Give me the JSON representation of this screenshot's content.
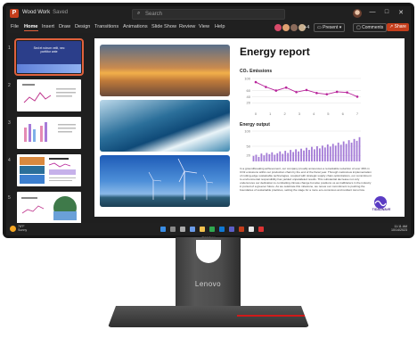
{
  "titlebar": {
    "app_icon": "powerpoint-icon",
    "doc_name": "Wood Work",
    "save_state": "Saved",
    "search_placeholder": "Search",
    "window_controls": [
      "—",
      "□",
      "✕"
    ]
  },
  "ribbon": {
    "tabs": [
      "File",
      "Home",
      "Insert",
      "Draw",
      "Design",
      "Transitions",
      "Animations",
      "Slide Show",
      "Review",
      "View",
      "Help"
    ],
    "active_tab": "Home",
    "collaborators_extra": "+4",
    "present_label": "Present",
    "comments_label": "Comments",
    "share_label": "Share"
  },
  "thumbnails": {
    "numbers": [
      "1",
      "2",
      "3",
      "4",
      "5"
    ],
    "slide1_text": "Sed et rutrum velit, nec porttitor ante"
  },
  "slide": {
    "title": "Energy report",
    "emissions_label": "CO₂ Emissions",
    "output_label": "Energy output",
    "paragraph": "In a groundbreaking achievement, our company proudly announces a remarkable reduction of over 30% in CO2 emissions within our production chain by the end of the fiscal year. Through meticulous implementation of cutting-edge sustainable technologies, coupled with strategic supply chain optimizations, our commitment to environmental responsibility has yielded unparalleled results. This substantial decrease not only underscores our dedication to combatting climate change but also positions us as trailblazers in the industry in pursuit of a greener future. As we celebrate this milestone, we renew our commitment to pushing the boundaries of sustainable practices, setting the stage for a more eco-conscious and resilient tomorrow.",
    "logo_text": "TIDALWAVE"
  },
  "taskbar": {
    "weather_temp": "78°F",
    "weather_desc": "Sunny",
    "time": "11:11 AM",
    "date": "10/14/2023"
  },
  "monitor": {
    "brand": "Lenovo",
    "hinge_label": "ThinkVision"
  },
  "colors": {
    "accent": "#c43e1c",
    "chart_line": "#b8239a",
    "chart_bar": "#a37ad6"
  },
  "chart_data": [
    {
      "type": "line",
      "title": "CO₂ Emissions",
      "x": [
        0,
        1,
        2,
        3,
        4,
        5,
        6,
        7
      ],
      "y": [
        88,
        72,
        60,
        70,
        55,
        62,
        52,
        48,
        56,
        54,
        40
      ],
      "ylim": [
        0,
        100
      ],
      "ytick_labels": [
        "100",
        "60",
        "40",
        "20"
      ],
      "xtick_labels": [
        "0",
        "1",
        "2",
        "3",
        "4",
        "5",
        "6",
        "7"
      ],
      "grid": true
    },
    {
      "type": "bar",
      "title": "Energy output",
      "values": [
        18,
        22,
        15,
        26,
        20,
        28,
        24,
        30,
        22,
        27,
        33,
        25,
        35,
        28,
        38,
        31,
        40,
        33,
        42,
        36,
        45,
        38,
        48,
        40,
        50,
        43,
        52,
        46,
        56,
        49,
        58,
        52,
        62,
        55,
        66,
        58,
        70,
        62,
        74,
        68,
        80
      ],
      "ylim": [
        0,
        100
      ],
      "ytick_labels": [
        "100",
        "50",
        "20"
      ],
      "grid": true
    }
  ]
}
